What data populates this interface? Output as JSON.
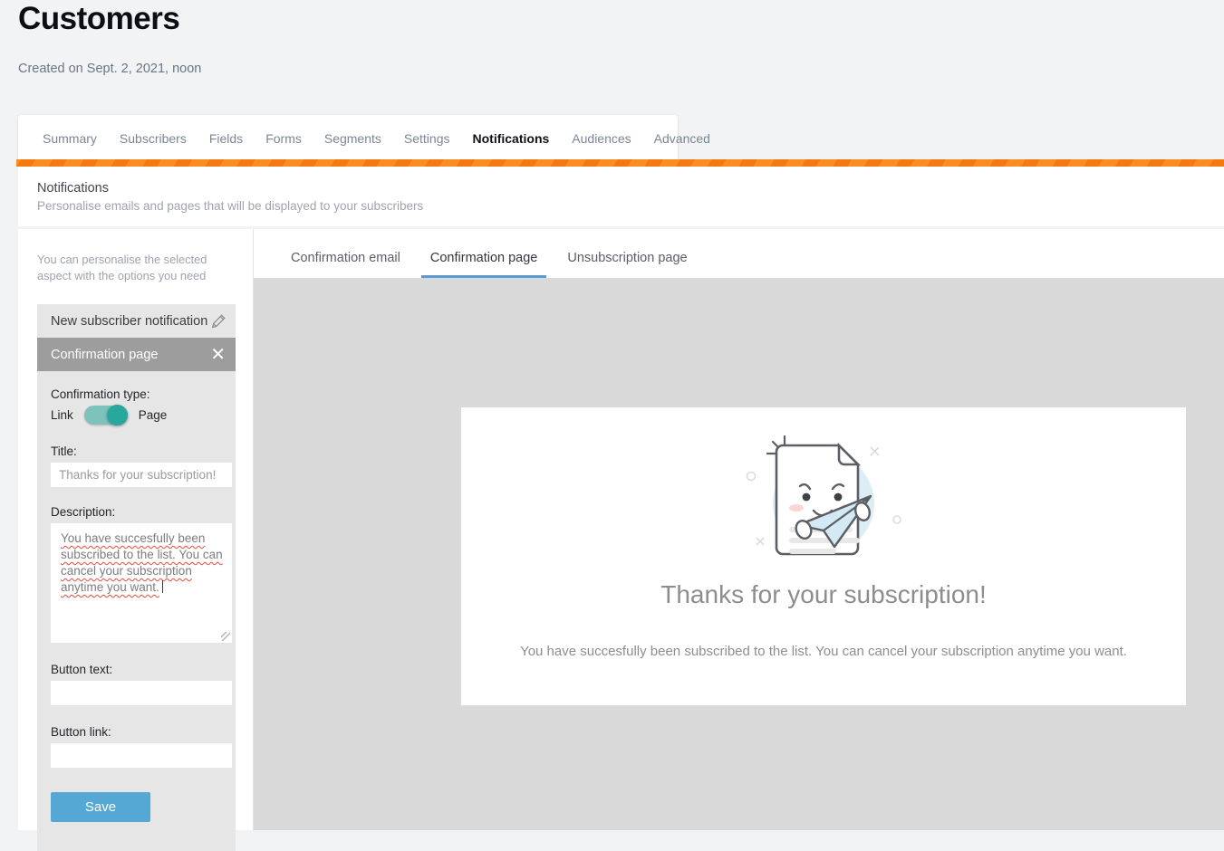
{
  "header": {
    "title": "Customers",
    "subtitle": "Created on Sept. 2, 2021, noon"
  },
  "nav_tabs": [
    {
      "label": "Summary",
      "active": false
    },
    {
      "label": "Subscribers",
      "active": false
    },
    {
      "label": "Fields",
      "active": false
    },
    {
      "label": "Forms",
      "active": false
    },
    {
      "label": "Segments",
      "active": false
    },
    {
      "label": "Settings",
      "active": false
    },
    {
      "label": "Notifications",
      "active": true
    },
    {
      "label": "Audiences",
      "active": false
    },
    {
      "label": "Advanced",
      "active": false
    }
  ],
  "panel": {
    "title": "Notifications",
    "subtitle": "Personalise emails and pages that will be displayed to your subscribers"
  },
  "sidebar": {
    "help_text": "You can personalise the selected aspect with the options you need",
    "items": [
      {
        "label": "New subscriber notification",
        "icon": "pencil-icon",
        "active": false
      },
      {
        "label": "Confirmation page",
        "icon": "close-icon",
        "active": true
      }
    ],
    "options": {
      "confirmation_type_label": "Confirmation type:",
      "toggle_left_label": "Link",
      "toggle_right_label": "Page",
      "toggle_state": "Page",
      "title_label": "Title:",
      "title_value": "",
      "title_placeholder": "Thanks for your subscription!",
      "description_label": "Description:",
      "description_value": "You have succesfully been subscribed to the list. You can cancel your subscription anytime you want.",
      "button_text_label": "Button text:",
      "button_text_value": "",
      "button_link_label": "Button link:",
      "button_link_value": "",
      "save_label": "Save"
    }
  },
  "content_tabs": [
    {
      "label": "Confirmation email",
      "active": false
    },
    {
      "label": "Confirmation page",
      "active": true
    },
    {
      "label": "Unsubscription page",
      "active": false
    }
  ],
  "preview": {
    "heading": "Thanks for your subscription!",
    "body": "You have succesfully been subscribed to the list. You can cancel your subscription anytime you want.",
    "illustration": "document-with-paper-plane-illustration"
  },
  "colors": {
    "accent_orange": "#fb8c21",
    "accent_blue": "#5b9bd5",
    "save_blue": "#55a8d3",
    "toggle_track": "#7dc2bb",
    "toggle_knob": "#27a79d",
    "page_bg": "#f1f3f5",
    "stage_bg": "#d9d9d9"
  }
}
